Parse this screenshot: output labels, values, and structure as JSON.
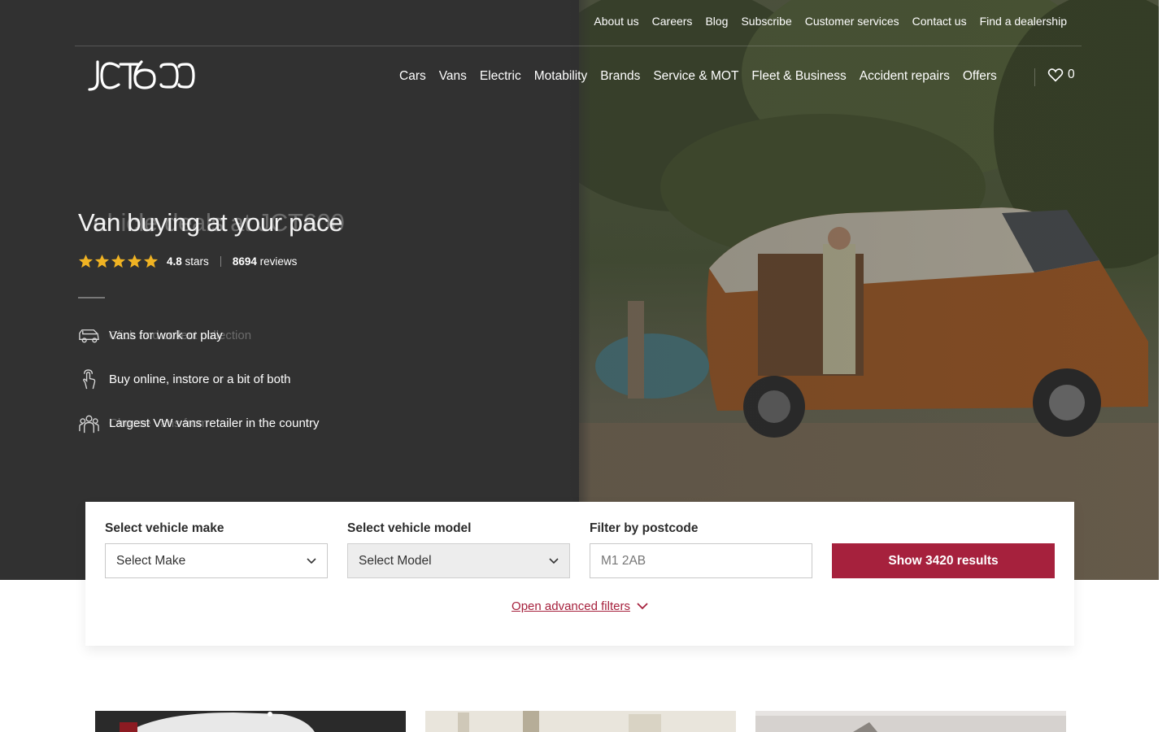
{
  "utility_nav": [
    "About us",
    "Careers",
    "Blog",
    "Subscribe",
    "Customer services",
    "Contact us",
    "Find a dealership"
  ],
  "main_nav": [
    "Cars",
    "Vans",
    "Electric",
    "Motability",
    "Brands",
    "Service & MOT",
    "Fleet & Business",
    "Accident repairs",
    "Offers"
  ],
  "wishlist": {
    "count": "0",
    "icon": "heart-icon"
  },
  "hero": {
    "title": "Van buying at your pace",
    "title_ghost": "Vehicle deals at JCT600",
    "rating": {
      "stars": 5,
      "score": "4.8",
      "score_label": "stars",
      "reviews": "8694",
      "reviews_label": "reviews"
    },
    "features": [
      {
        "icon": "van-icon",
        "text": "Vans for work or play",
        "ghost": "Click and collect collection"
      },
      {
        "icon": "touch-hand-icon",
        "text": "Buy online, instore or a bit of both",
        "ghost": ""
      },
      {
        "icon": "people-group-icon",
        "text": "Largest VW vans retailer in the country",
        "ghost": "Choose vans from"
      }
    ]
  },
  "search": {
    "make_label": "Select vehicle make",
    "make_value": "Select Make",
    "model_label": "Select vehicle model",
    "model_value": "Select Model",
    "postcode_label": "Filter by postcode",
    "postcode_placeholder": "M1 2AB",
    "results_button": "Show 3420 results",
    "advanced_filters": "Open advanced filters"
  },
  "colors": {
    "accent": "#a6213d",
    "hero_bg": "#313131",
    "star": "#f0b323"
  }
}
